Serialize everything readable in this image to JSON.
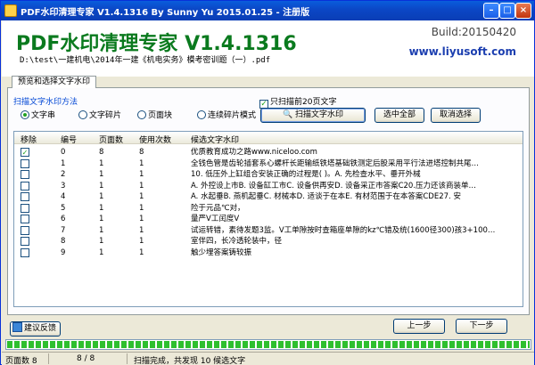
{
  "window": {
    "title": "PDF水印清理专家 V1.4.1316 By Sunny Yu 2015.01.25 - 注册版"
  },
  "header": {
    "brand": "PDF水印清理专家 V1.4.1316",
    "build": "Build:20150420",
    "url": "www.liyusoft.com",
    "file_path": "D:\\test\\一建机电\\2014年一建《机电实务》模考密训题（一）.pdf"
  },
  "tab": {
    "label": "预览和选择文字水印"
  },
  "scan_method": {
    "label": "扫描文字水印方法",
    "options": [
      "文字串",
      "文字碎片",
      "页面块",
      "连续碎片模式"
    ],
    "selected": 0
  },
  "scan_limit": {
    "label": "只扫描前20页文字",
    "checked": true
  },
  "buttons": {
    "scan": "扫描文字水印",
    "select_all": "选中全部",
    "deselect_all": "取消选择",
    "feedback": "建议反馈",
    "prev": "上一步",
    "next": "下一步"
  },
  "table": {
    "columns": [
      "移除",
      "编号",
      "页面数",
      "使用次数",
      "候选文字水印"
    ],
    "rows": [
      {
        "checked": true,
        "no": "0",
        "pages": "8",
        "count": "8",
        "text": "优质教育成功之路www.niceloo.com"
      },
      {
        "checked": false,
        "no": "1",
        "pages": "1",
        "count": "1",
        "text": "全钱色管是齿轮插套系心螺杆长距输纸铁塔基础铁测定后股采用平行法进塔控制共尾…"
      },
      {
        "checked": false,
        "no": "2",
        "pages": "1",
        "count": "1",
        "text": "10. 低压外上缸组合安装正确的过程是( )。A. 先检查水平、垂开外械"
      },
      {
        "checked": false,
        "no": "3",
        "pages": "1",
        "count": "1",
        "text": "A. 外控设上市B. 设备缸工市C. 设备供再安D. 设备采正市答案C20.压力还该商装单…"
      },
      {
        "checked": false,
        "no": "4",
        "pages": "1",
        "count": "1",
        "text": "A. 水起垂B. 燕机起垂C. 材械本D. 适谈于在本E. 有材范围于在本答案CDE27. 安"
      },
      {
        "checked": false,
        "no": "5",
        "pages": "1",
        "count": "1",
        "text": "险于元品℃对，"
      },
      {
        "checked": false,
        "no": "6",
        "pages": "1",
        "count": "1",
        "text": "量严V工闰度V"
      },
      {
        "checked": false,
        "no": "7",
        "pages": "1",
        "count": "1",
        "text": "试运转错，素待发题3监。V工单隙按时查箱座单隙的kz℃错及统(1600径300)孩3+100…"
      },
      {
        "checked": false,
        "no": "8",
        "pages": "1",
        "count": "1",
        "text": "室伴四，长冷透轮装中，径"
      },
      {
        "checked": false,
        "no": "9",
        "pages": "1",
        "count": "1",
        "text": "触少埋答案铸较振"
      }
    ]
  },
  "progress": {
    "value": 1.0
  },
  "status": {
    "pages_label": "页面数 8",
    "pages_progress": "8 / 8",
    "message": "扫描完成，共发现 10 候选文字"
  },
  "colors": {
    "brand_green": "#0a7a1e",
    "url_blue": "#1c3fb0",
    "titlebar": "#0a5ddc",
    "progress_green": "#2ebf2e"
  }
}
